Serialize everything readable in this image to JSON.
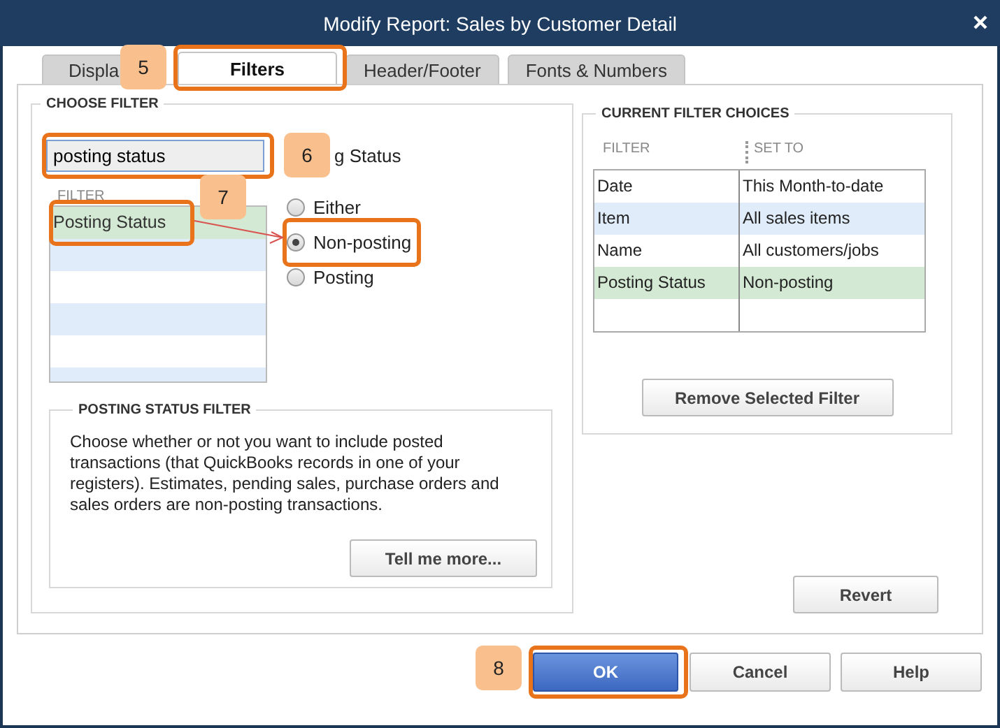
{
  "window": {
    "title": "Modify Report: Sales by Customer Detail"
  },
  "tabs": [
    {
      "label": "Displa",
      "selected": false,
      "highlighted": false
    },
    {
      "label": "Filters",
      "selected": true,
      "highlighted": true,
      "callout": "5"
    },
    {
      "label": "Header/Footer",
      "selected": false,
      "highlighted": false
    },
    {
      "label": "Fonts & Numbers",
      "selected": false,
      "highlighted": false
    }
  ],
  "choose_filter": {
    "heading": "CHOOSE FILTER",
    "search": {
      "value": "posting status",
      "highlighted": true,
      "callout": "6"
    },
    "filter_label": "g Status",
    "list": {
      "header": "FILTER",
      "items": [
        {
          "label": "Posting Status",
          "selected": true,
          "highlighted": true,
          "callout": "7"
        }
      ]
    },
    "options": [
      {
        "label": "Either",
        "selected": false,
        "highlighted": false
      },
      {
        "label": "Non-posting",
        "selected": true,
        "highlighted": true
      },
      {
        "label": "Posting",
        "selected": false,
        "highlighted": false
      }
    ],
    "description": {
      "heading": "POSTING STATUS FILTER",
      "text": "Choose whether or not you want to include posted transactions (that QuickBooks records in one of your registers). Estimates, pending sales, purchase orders and sales orders are non-posting transactions.",
      "button": "Tell me more..."
    }
  },
  "current_filters": {
    "heading": "CURRENT FILTER CHOICES",
    "columns": [
      "FILTER",
      "SET TO"
    ],
    "rows": [
      {
        "filter": "Date",
        "set_to": "This Month-to-date",
        "selected": false
      },
      {
        "filter": "Item",
        "set_to": "All sales items",
        "selected": false
      },
      {
        "filter": "Name",
        "set_to": "All customers/jobs",
        "selected": false
      },
      {
        "filter": "Posting Status",
        "set_to": "Non-posting",
        "selected": true
      }
    ],
    "button": "Remove Selected Filter"
  },
  "revert": "Revert",
  "buttons": [
    {
      "label": "OK",
      "kind": "default",
      "highlighted": true,
      "callout": "8"
    },
    {
      "label": "Cancel",
      "kind": "normal",
      "highlighted": false
    },
    {
      "label": "Help",
      "kind": "normal",
      "highlighted": false
    }
  ]
}
